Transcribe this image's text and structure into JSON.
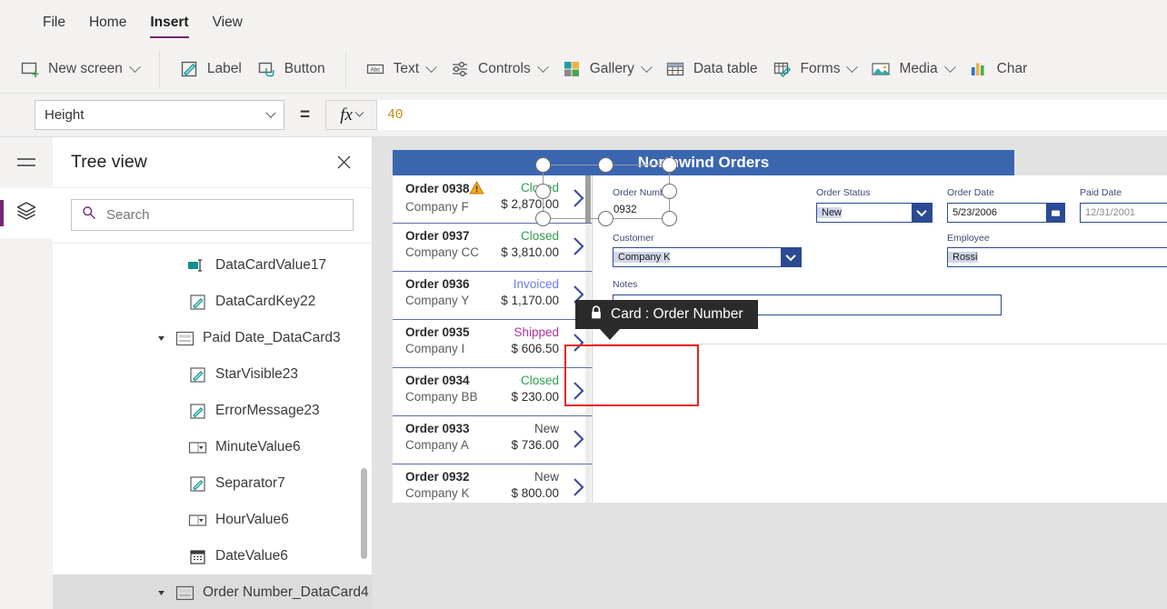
{
  "menu": {
    "items": [
      {
        "label": "File",
        "active": false
      },
      {
        "label": "Home",
        "active": false
      },
      {
        "label": "Insert",
        "active": true
      },
      {
        "label": "View",
        "active": false
      }
    ]
  },
  "ribbon": {
    "groups": [
      {
        "buttons": [
          {
            "label": "New screen",
            "icon": "new-screen-icon",
            "caret": true
          }
        ]
      },
      {
        "buttons": [
          {
            "label": "Label",
            "icon": "label-icon",
            "caret": false
          },
          {
            "label": "Button",
            "icon": "button-icon",
            "caret": false
          }
        ]
      },
      {
        "buttons": [
          {
            "label": "Text",
            "icon": "text-icon",
            "caret": true
          },
          {
            "label": "Controls",
            "icon": "controls-icon",
            "caret": true
          },
          {
            "label": "Gallery",
            "icon": "gallery-icon",
            "caret": true
          },
          {
            "label": "Data table",
            "icon": "data-table-icon",
            "caret": false
          },
          {
            "label": "Forms",
            "icon": "forms-icon",
            "caret": true
          },
          {
            "label": "Media",
            "icon": "media-icon",
            "caret": true
          },
          {
            "label": "Char",
            "icon": "charts-icon",
            "caret": false
          }
        ]
      }
    ]
  },
  "formula_bar": {
    "property": "Height",
    "equals": "=",
    "fx_label": "fx",
    "value": "40"
  },
  "tree_view": {
    "title": "Tree view",
    "close_label": "✕",
    "search_placeholder": "Search",
    "search_value": "",
    "nodes": [
      {
        "label": "DataCardValue17",
        "icon": "text-input-icon",
        "indent": 3,
        "twist": false,
        "selected": false
      },
      {
        "label": "DataCardKey22",
        "icon": "label-icon",
        "indent": 3,
        "twist": false,
        "selected": false
      },
      {
        "label": "Paid Date_DataCard3",
        "icon": "datacard-icon",
        "indent": 2,
        "twist": true,
        "selected": false
      },
      {
        "label": "StarVisible23",
        "icon": "label-icon",
        "indent": 3,
        "twist": false,
        "selected": false
      },
      {
        "label": "ErrorMessage23",
        "icon": "label-icon",
        "indent": 3,
        "twist": false,
        "selected": false
      },
      {
        "label": "MinuteValue6",
        "icon": "dropdown-icon",
        "indent": 3,
        "twist": false,
        "selected": false
      },
      {
        "label": "Separator7",
        "icon": "label-icon",
        "indent": 3,
        "twist": false,
        "selected": false
      },
      {
        "label": "HourValue6",
        "icon": "dropdown-icon",
        "indent": 3,
        "twist": false,
        "selected": false
      },
      {
        "label": "DateValue6",
        "icon": "datepicker-icon",
        "indent": 3,
        "twist": false,
        "selected": false
      },
      {
        "label": "Order Number_DataCard4",
        "icon": "datacard-icon",
        "indent": 2,
        "twist": true,
        "selected": true
      }
    ]
  },
  "tooltip": {
    "text": "Card : Order Number",
    "icon": "lock-icon"
  },
  "app": {
    "title": "Northwind Orders",
    "header_color": "#3a66b0",
    "gallery": {
      "items": [
        {
          "order": "Order 0938",
          "company": "Company F",
          "status": "Closed",
          "status_color": "#2e9e4f",
          "amount": "$ 2,870.00",
          "warning": true
        },
        {
          "order": "Order 0937",
          "company": "Company CC",
          "status": "Closed",
          "status_color": "#2e9e4f",
          "amount": "$ 3,810.00",
          "warning": false
        },
        {
          "order": "Order 0936",
          "company": "Company Y",
          "status": "Invoiced",
          "status_color": "#6c7bf0",
          "amount": "$ 1,170.00",
          "warning": false
        },
        {
          "order": "Order 0935",
          "company": "Company I",
          "status": "Shipped",
          "status_color": "#b0339e",
          "amount": "$ 606.50",
          "warning": false
        },
        {
          "order": "Order 0934",
          "company": "Company BB",
          "status": "Closed",
          "status_color": "#2e9e4f",
          "amount": "$ 230.00",
          "warning": false
        },
        {
          "order": "Order 0933",
          "company": "Company A",
          "status": "New",
          "status_color": "#4a4a4a",
          "amount": "$ 736.00",
          "warning": false
        },
        {
          "order": "Order 0932",
          "company": "Company K",
          "status": "New",
          "status_color": "#4a4a4a",
          "amount": "$ 800.00",
          "warning": false
        }
      ]
    },
    "form": {
      "order_number": {
        "label": "Order Number",
        "value": "0932"
      },
      "order_status": {
        "label": "Order Status",
        "value": "New"
      },
      "order_date": {
        "label": "Order Date",
        "value": "5/23/2006"
      },
      "paid_date": {
        "label": "Paid Date",
        "value": "12/31/2001"
      },
      "customer": {
        "label": "Customer",
        "value": "Company K"
      },
      "employee": {
        "label": "Employee",
        "value": "Rossi"
      },
      "notes": {
        "label": "Notes",
        "value": ""
      }
    }
  },
  "colors": {
    "accent": "#742774",
    "app_blue": "#3a66b0",
    "control_blue": "#2a4a94",
    "selection_red": "#e8221e",
    "formula_value": "#c18a16"
  }
}
